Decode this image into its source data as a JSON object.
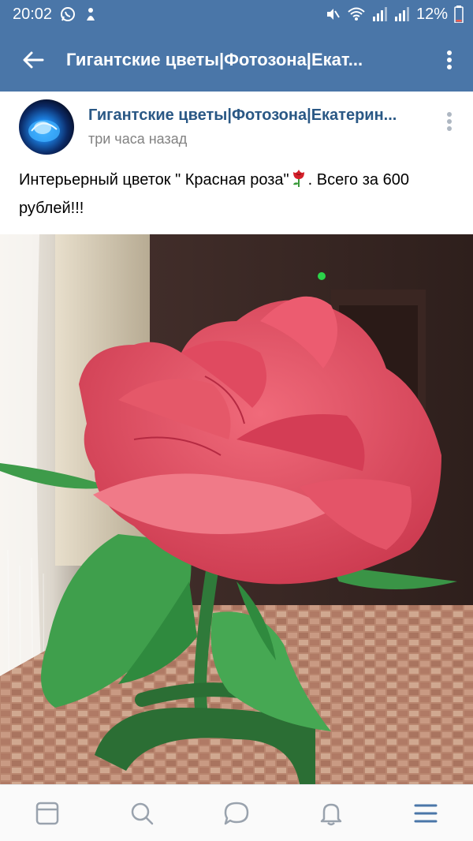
{
  "status_bar": {
    "time": "20:02",
    "battery": "12%"
  },
  "app_bar": {
    "title": "Гигантские цветы|Фотозона|Екат..."
  },
  "post": {
    "author": "Гигантские цветы|Фотозона|Екатерин...",
    "time": "три часа назад",
    "text_before_emoji": "Интерьерный цветок \" Красная роза\"",
    "text_after_emoji": ". Всего за 600 рублей!!!",
    "photo_subject": "giant-red-foam-rose"
  },
  "bottom_nav": {
    "items": [
      "news-icon",
      "search-icon",
      "messages-icon",
      "notifications-icon",
      "menu-icon"
    ],
    "active": "menu-icon"
  },
  "colors": {
    "header": "#4a76a8",
    "author_link": "#2a5885",
    "meta_text": "#828282",
    "nav_icon": "#99a2ad",
    "nav_active": "#4a76a8"
  }
}
